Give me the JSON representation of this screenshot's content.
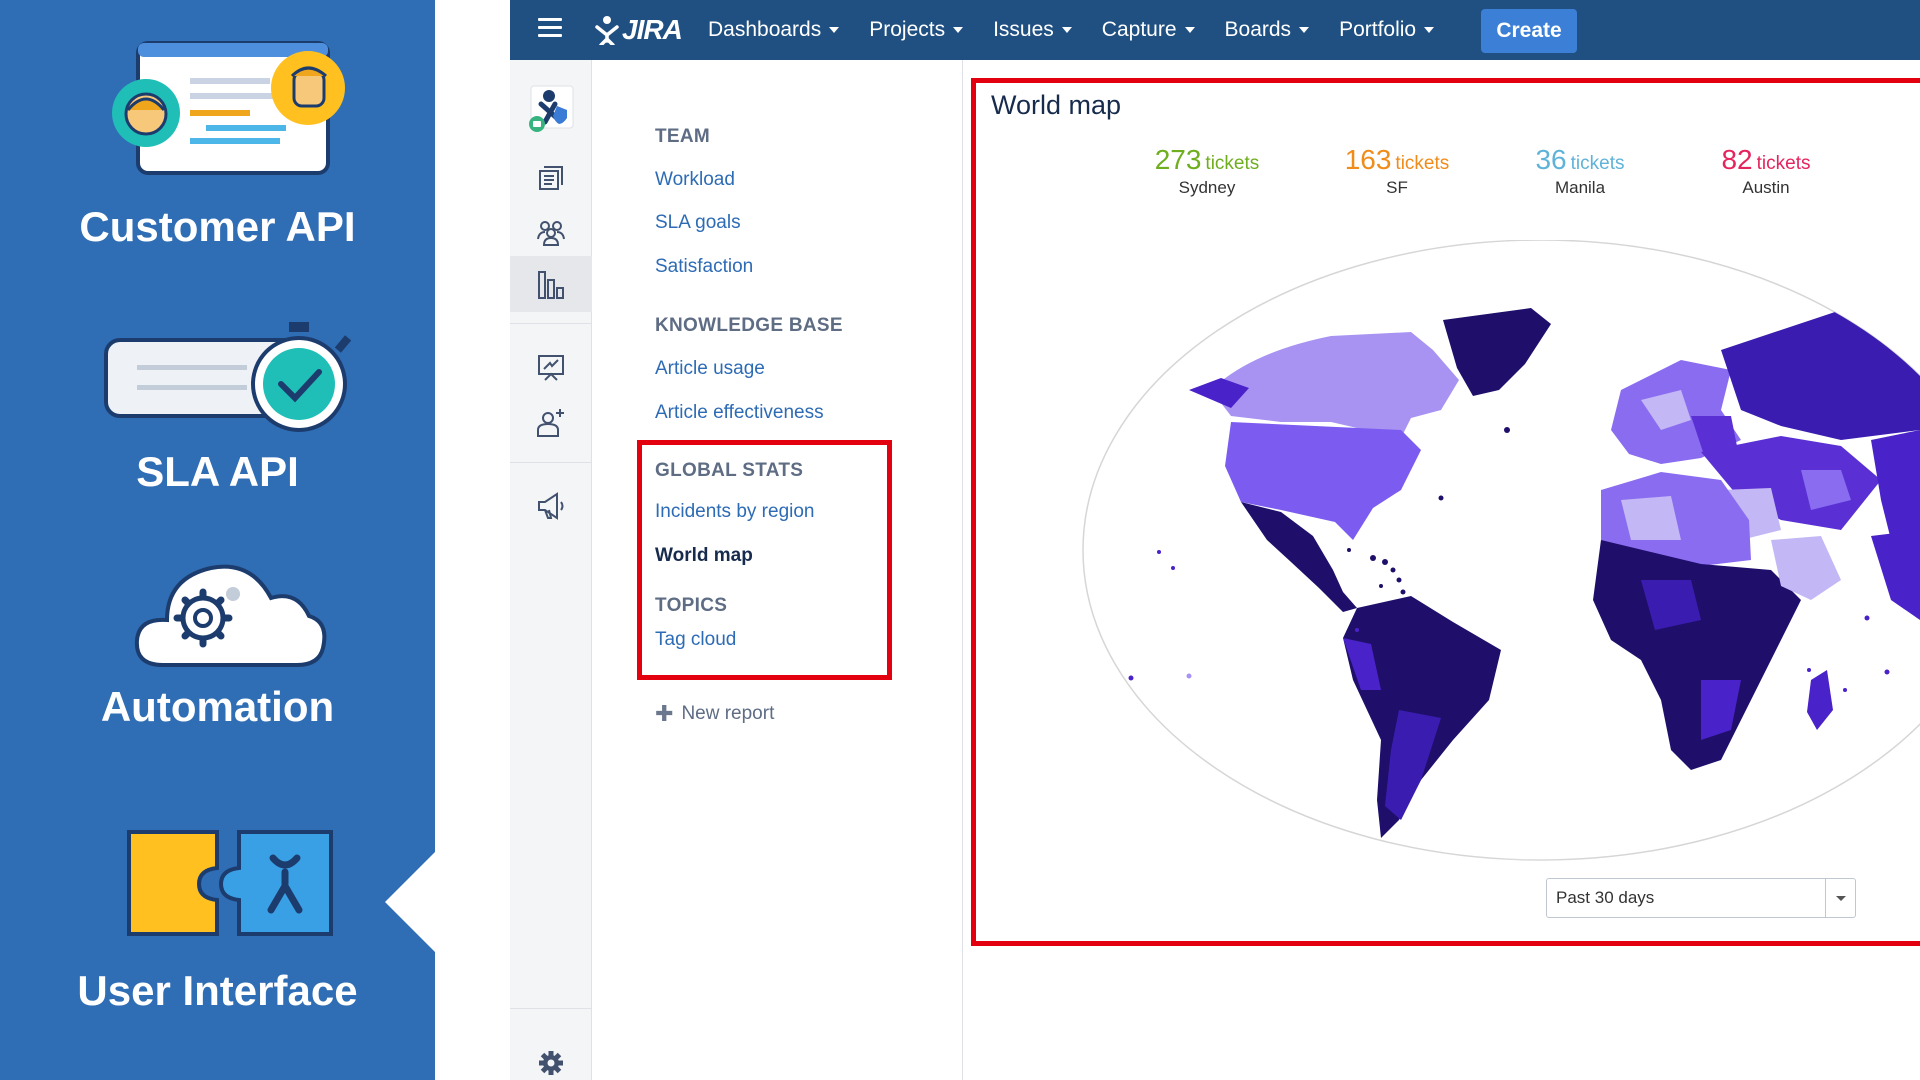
{
  "promo": {
    "items": [
      {
        "label": "Customer API",
        "icon": "customer-chat-illustration"
      },
      {
        "label": "SLA API",
        "icon": "sla-timer-illustration"
      },
      {
        "label": "Automation",
        "icon": "cloud-gear-illustration"
      },
      {
        "label": "User Interface",
        "icon": "puzzle-atlassian-illustration"
      }
    ]
  },
  "topnav": {
    "logo": "JIRA",
    "menu": [
      "Dashboards",
      "Projects",
      "Issues",
      "Capture",
      "Boards",
      "Portfolio"
    ],
    "create_label": "Create",
    "colors": {
      "bar": "#205081",
      "create": "#3b7fd6"
    }
  },
  "rail": {
    "icons": [
      "project-avatar-icon",
      "queues-icon",
      "customers-icon",
      "reports-icon",
      "knowledge-icon",
      "invite-icon",
      "announce-icon",
      "settings-icon"
    ],
    "active": "reports-icon"
  },
  "reports": {
    "sections": [
      {
        "heading": "TEAM",
        "links": [
          "Workload",
          "SLA goals",
          "Satisfaction"
        ]
      },
      {
        "heading": "KNOWLEDGE BASE",
        "links": [
          "Article usage",
          "Article effectiveness"
        ]
      },
      {
        "heading": "GLOBAL STATS",
        "links": [
          "Incidents by region",
          "World map"
        ]
      },
      {
        "heading": "TOPICS",
        "links": [
          "Tag cloud"
        ]
      }
    ],
    "current": "World map",
    "new_report": "New report"
  },
  "main": {
    "title": "World map",
    "stats": [
      {
        "value": "273",
        "unit": "tickets",
        "city": "Sydney",
        "color": "#6fae1e"
      },
      {
        "value": "163",
        "unit": "tickets",
        "city": "SF",
        "color": "#f08c1a"
      },
      {
        "value": "36",
        "unit": "tickets",
        "city": "Manila",
        "color": "#5fb3d8"
      },
      {
        "value": "82",
        "unit": "tickets",
        "city": "Austin",
        "color": "#e5245e"
      }
    ],
    "range": {
      "selected": "Past 30 days"
    },
    "map_colors": {
      "dark": "#1f0f6b",
      "mid": "#4a22c9",
      "light": "#8a6cf0",
      "pale": "#c4b7f6",
      "ice": "#e3e3e3"
    }
  }
}
